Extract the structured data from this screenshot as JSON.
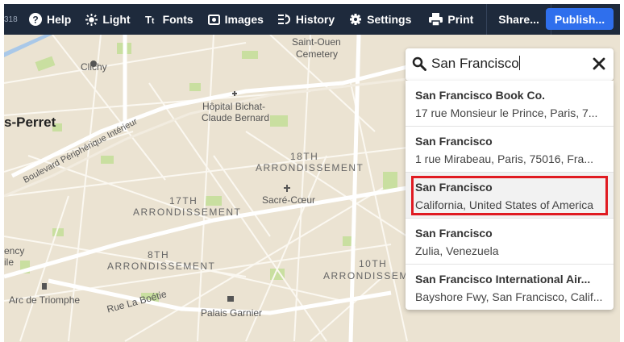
{
  "toolbar": {
    "cut_text": "318",
    "items": [
      {
        "label": "Help",
        "icon": "help-icon"
      },
      {
        "label": "Light",
        "icon": "sun-icon"
      },
      {
        "label": "Fonts",
        "icon": "fonts-icon"
      },
      {
        "label": "Images",
        "icon": "image-icon"
      },
      {
        "label": "History",
        "icon": "history-icon"
      },
      {
        "label": "Settings",
        "icon": "gear-icon"
      },
      {
        "label": "Print",
        "icon": "print-icon"
      }
    ],
    "share_label": "Share...",
    "publish_label": "Publish..."
  },
  "search": {
    "value": "San Francisco",
    "placeholder": ""
  },
  "results": [
    {
      "title": "San Francisco Book Co.",
      "subtitle": "17 rue Monsieur le Prince, Paris, 7..."
    },
    {
      "title": "San Francisco",
      "subtitle": "1 rue Mirabeau, Paris, 75016, Fra..."
    },
    {
      "title": "San Francisco",
      "subtitle": "California, United States of America",
      "highlighted": true
    },
    {
      "title": "San Francisco",
      "subtitle": "Zulia, Venezuela"
    },
    {
      "title": "San Francisco International Air...",
      "subtitle": "Bayshore Fwy, San Francisco, Calif..."
    }
  ],
  "map_labels": {
    "saint_ouen": "Saint-Ouen",
    "cemetery": "Cemetery",
    "clichy": "Clichy",
    "perret": "s-Perret",
    "peripherique": "Boulevard Périphérique Intérieur",
    "hopital": "Hôpital Bichat-",
    "hopital2": "Claude Bernard",
    "arr18a": "18TH",
    "arr18b": "ARRONDISSEMENT",
    "arr17a": "17TH",
    "arr17b": "ARRONDISSEMENT",
    "sacre": "Sacré-Cœur",
    "arr8a": "8TH",
    "arr8b": "ARRONDISSEMENT",
    "arr10a": "10TH",
    "arr10b": "ARRONDISSEME",
    "ency": "ency",
    "ile": "ile",
    "arc": "Arc de Triomphe",
    "boetie": "Rue La Boétie",
    "garnier": "Palais Garnier"
  },
  "colors": {
    "toolbar_bg": "#1e2a3c",
    "accent": "#2f6fed",
    "map_bg": "#ebe3d2",
    "park": "#c9dfa0",
    "highlight_border": "#e01b22"
  }
}
